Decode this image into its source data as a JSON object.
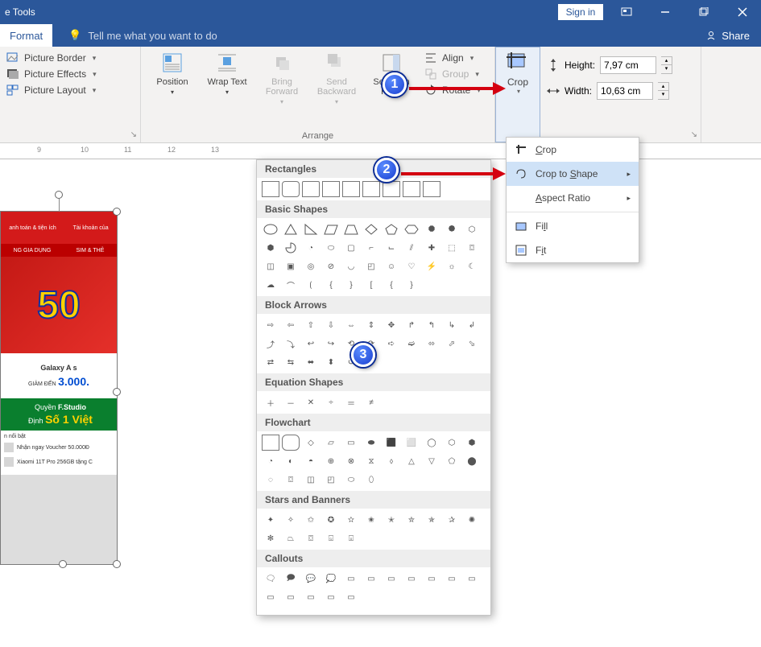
{
  "title_bar": {
    "title_fragment": "e Tools",
    "sign_in": "Sign in"
  },
  "tabs": {
    "format": "Format",
    "tellme_placeholder": "Tell me what you want to do",
    "share": "Share"
  },
  "ribbon": {
    "picture_border": "Picture Border",
    "picture_effects": "Picture Effects",
    "picture_layout": "Picture Layout",
    "position": "Position",
    "wrap_text": "Wrap Text",
    "bring_forward": "Bring Forward",
    "send_backward": "Send Backward",
    "selection_pane": "Selection Pane",
    "align": "Align",
    "group": "Group",
    "rotate": "Rotate",
    "arrange_label": "Arrange",
    "crop": "Crop",
    "height_label": "Height:",
    "height_value": "7,97 cm",
    "width_label": "Width:",
    "width_value": "10,63 cm"
  },
  "crop_menu": {
    "crop": "Crop",
    "crop_to_shape": "Crop to Shape",
    "aspect_ratio": "Aspect Ratio",
    "fill": "Fill",
    "fit": "Fit"
  },
  "shape_categories": {
    "rectangles": "Rectangles",
    "basic_shapes": "Basic Shapes",
    "block_arrows": "Block Arrows",
    "equation_shapes": "Equation Shapes",
    "flowchart": "Flowchart",
    "stars_banners": "Stars and Banners",
    "callouts": "Callouts"
  },
  "ruler": {
    "marks": [
      "9",
      "10",
      "11",
      "12",
      "13"
    ]
  },
  "image_content": {
    "tab1": "anh toán & tiện ích",
    "tab2": "Tài khoản của",
    "strip_top": "NG GIA DỤNG",
    "strip_top2": "SIM & THẺ",
    "promo_big": "50",
    "galaxy": "Galaxy A s",
    "giam": "GIẢM ĐẾN",
    "price": "3.000.",
    "fstudio_pre": "Quyền",
    "fstudio": "F.Studio",
    "dinh": "Định",
    "so1": "Số 1 Việt",
    "noibat": "n nổi bật",
    "row1": "Nhận ngay Voucher 50.000Đ",
    "row2": "Xiaomi 11T Pro 256GB tặng C"
  },
  "badges": {
    "b1": "1",
    "b2": "2",
    "b3": "3"
  }
}
